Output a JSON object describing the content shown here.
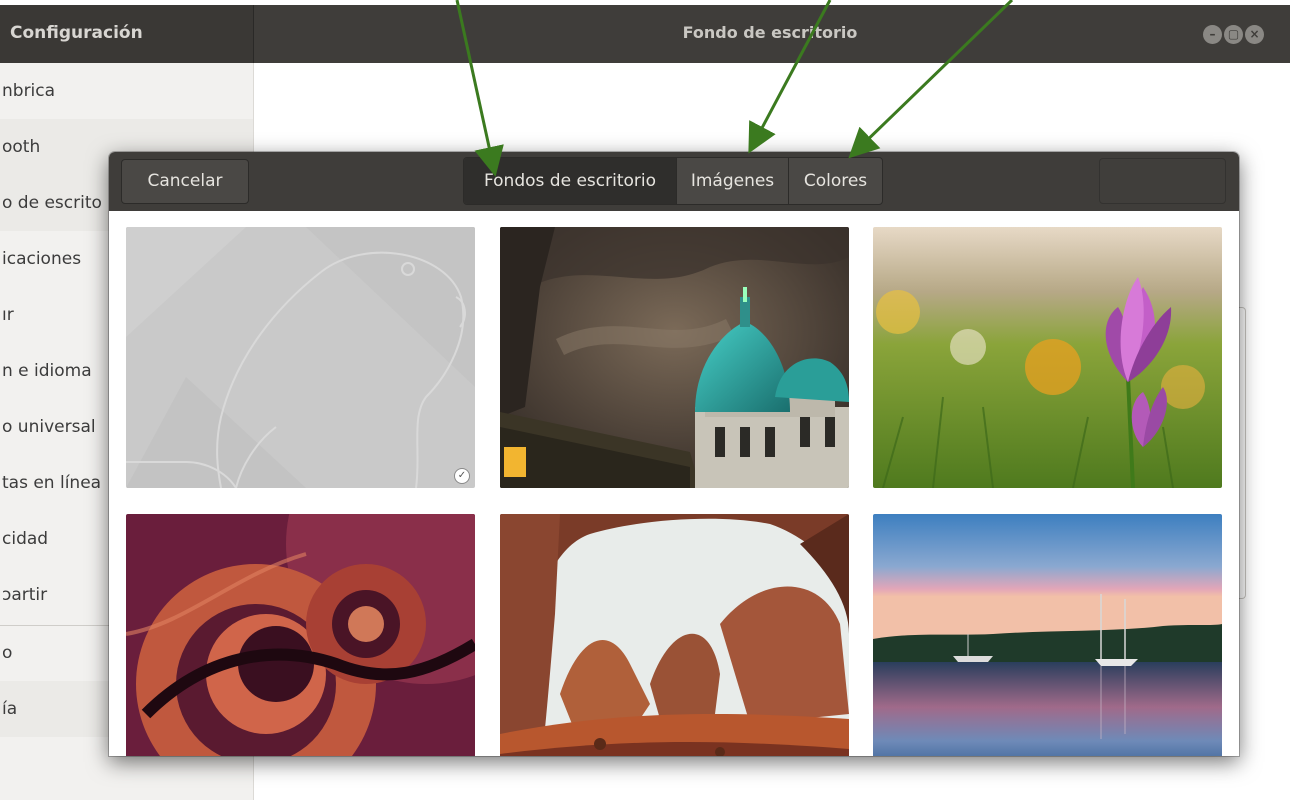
{
  "window": {
    "app_title": "Configuración",
    "title": "Fondo de escritorio",
    "controls": {
      "minimize": "–",
      "maximize": "▢",
      "close": "×"
    }
  },
  "sidebar": {
    "items": [
      {
        "label": "nbrica"
      },
      {
        "label": "ooth"
      },
      {
        "label": "o de escrito"
      },
      {
        "label": "icaciones"
      },
      {
        "label": "ır"
      },
      {
        "label": "n e idioma"
      },
      {
        "label": "o universal"
      },
      {
        "label": "tas en línea"
      },
      {
        "label": "cidad"
      },
      {
        "label": "ɔartir"
      },
      {
        "label": "o"
      },
      {
        "label": "ía"
      }
    ]
  },
  "dialog": {
    "cancel_label": "Cancelar",
    "tabs": [
      {
        "label": "Fondos de escritorio",
        "active": true
      },
      {
        "label": "Imágenes",
        "active": false
      },
      {
        "label": "Colores",
        "active": false
      }
    ],
    "select_label": "",
    "wallpapers": [
      {
        "name": "ubuntu-beaver-grey",
        "selected": true
      },
      {
        "name": "basilica-dome-night"
      },
      {
        "name": "purple-crocus"
      },
      {
        "name": "ubuntu-swirl-orange"
      },
      {
        "name": "rock-arch"
      },
      {
        "name": "lake-sailboats-sunset"
      }
    ],
    "selected_badge_icon": "check-circle-icon"
  },
  "annotations": {
    "arrow_color": "#3b7a1f",
    "arrows": 3
  }
}
